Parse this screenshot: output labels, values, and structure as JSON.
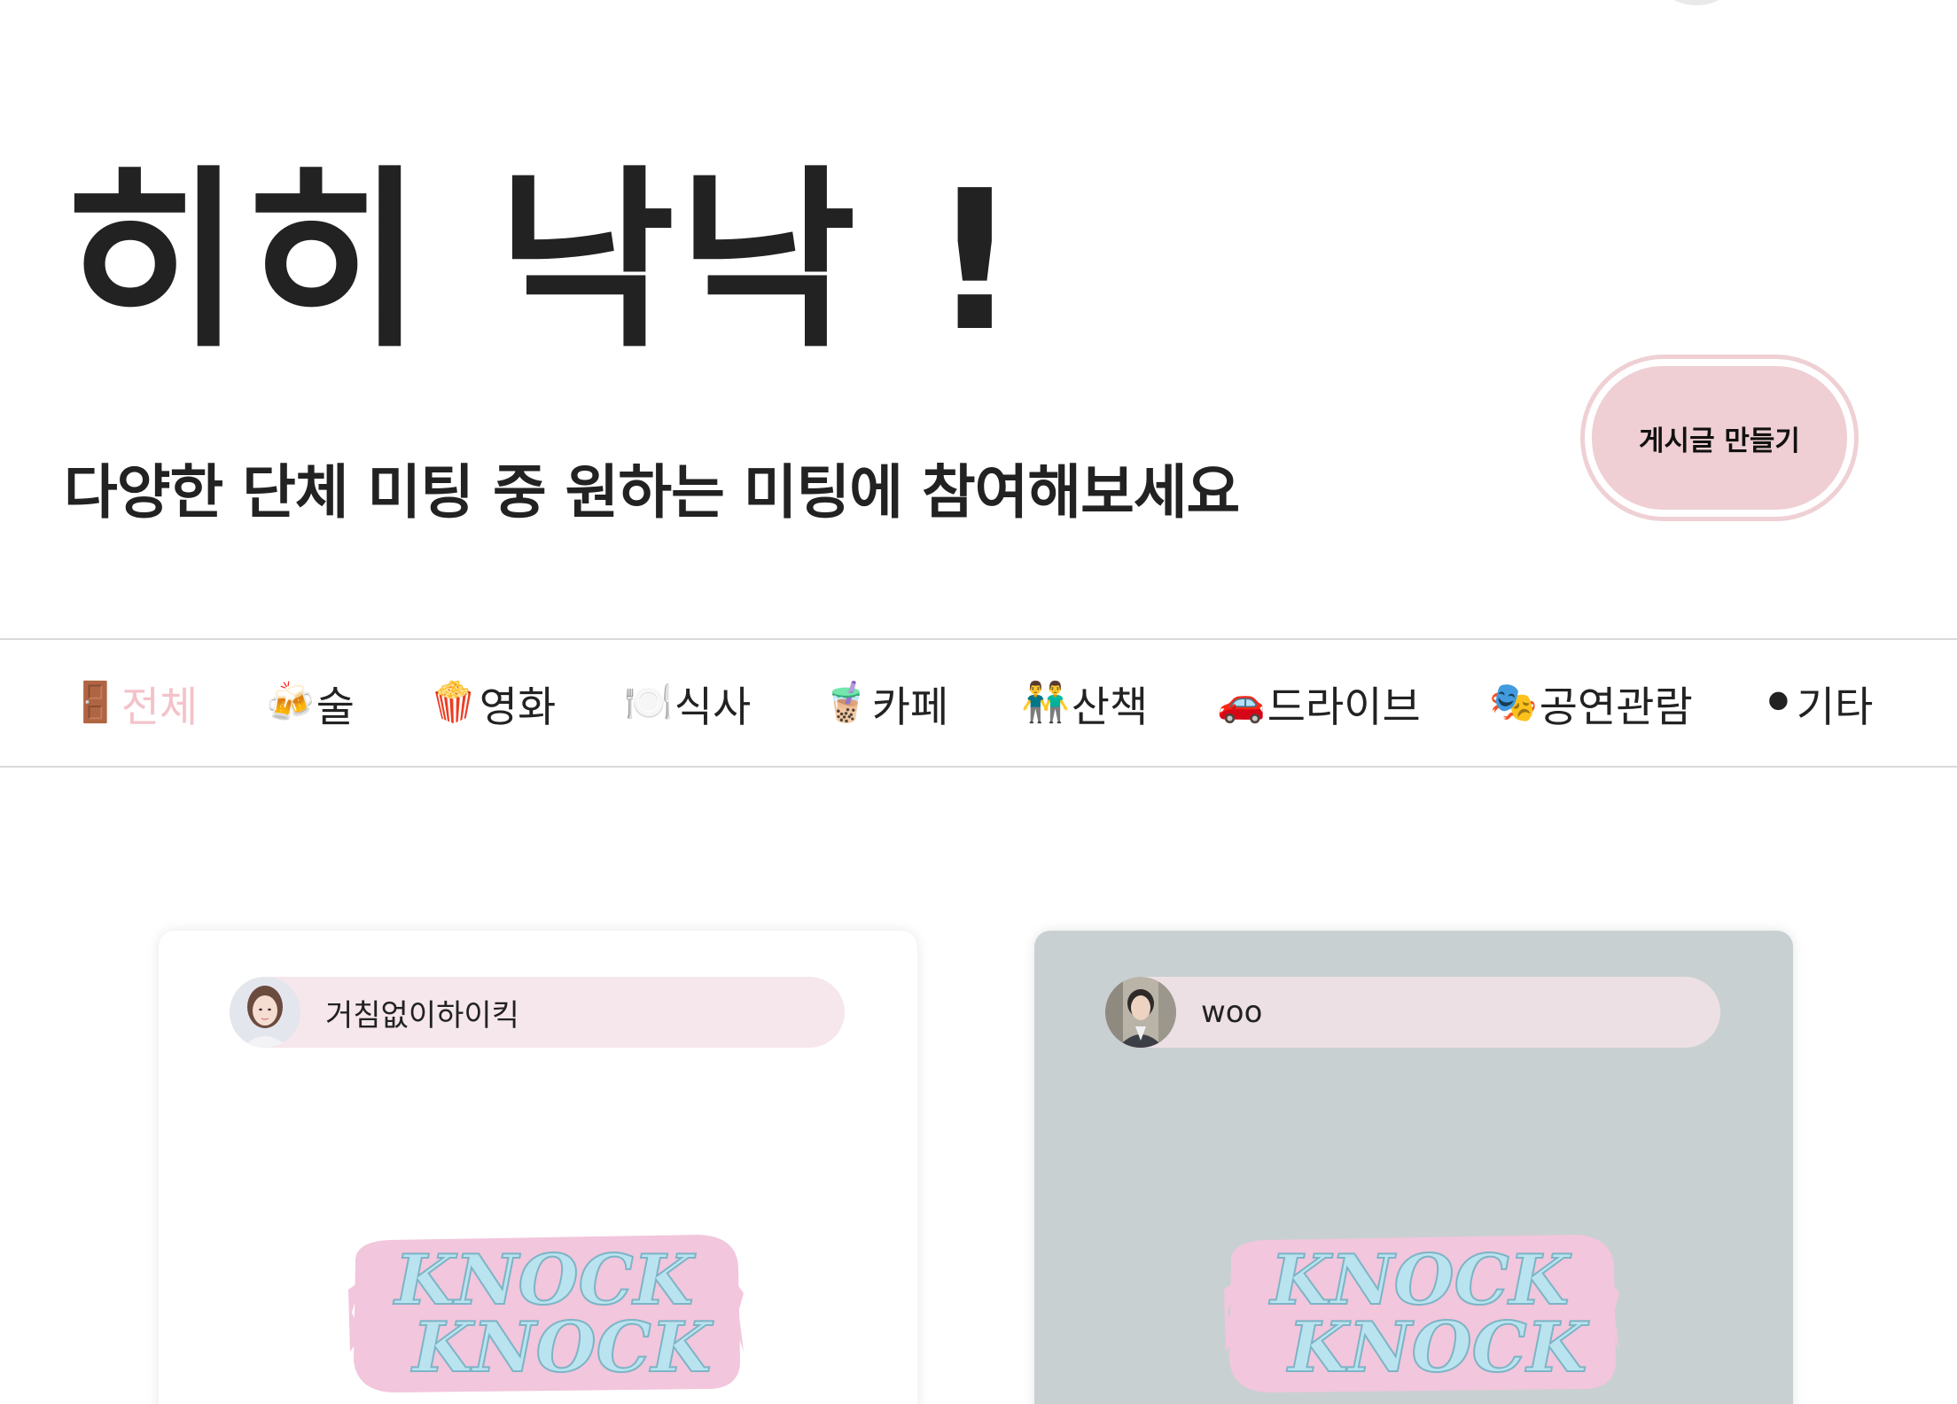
{
  "hero": {
    "title": "히히 낙낙 !",
    "subtitle": "다양한 단체 미팅 중 원하는 미팅에 참여해보세요"
  },
  "actions": {
    "create_post_label": "게시글 만들기"
  },
  "categories": [
    {
      "icon": "🚪",
      "icon_name": "door-icon",
      "label": "전체",
      "active": true
    },
    {
      "icon": "🍻",
      "icon_name": "beer-icon",
      "label": "술",
      "active": false
    },
    {
      "icon": "🍿",
      "icon_name": "popcorn-icon",
      "label": "영화",
      "active": false
    },
    {
      "icon": "🍽️",
      "icon_name": "plate-icon",
      "label": "식사",
      "active": false
    },
    {
      "icon": "🧋",
      "icon_name": "bubble-tea-icon",
      "label": "카페",
      "active": false
    },
    {
      "icon": "👬",
      "icon_name": "walking-people-icon",
      "label": "산책",
      "active": false
    },
    {
      "icon": "🚗",
      "icon_name": "car-icon",
      "label": "드라이브",
      "active": false
    },
    {
      "icon": "🎭",
      "icon_name": "theater-masks-icon",
      "label": "공연관람",
      "active": false
    },
    {
      "icon": "⚫",
      "icon_name": "black-circle-icon",
      "label": "기타",
      "active": false
    }
  ],
  "posts": [
    {
      "author": "거침없이하이킥",
      "logo_text_1": "KNOCK",
      "logo_text_2": "KNOCK"
    },
    {
      "author": "woo",
      "logo_text_1": "KNOCK",
      "logo_text_2": "KNOCK"
    }
  ],
  "colors": {
    "accent_pink": "#efcfd3",
    "active_category": "#f3c3c9",
    "pill_pink": "#f5e7ec",
    "card_gray": "#c9d0d2",
    "logo_blue": "#b9e4ef",
    "logo_pink": "#f2c6dc"
  }
}
